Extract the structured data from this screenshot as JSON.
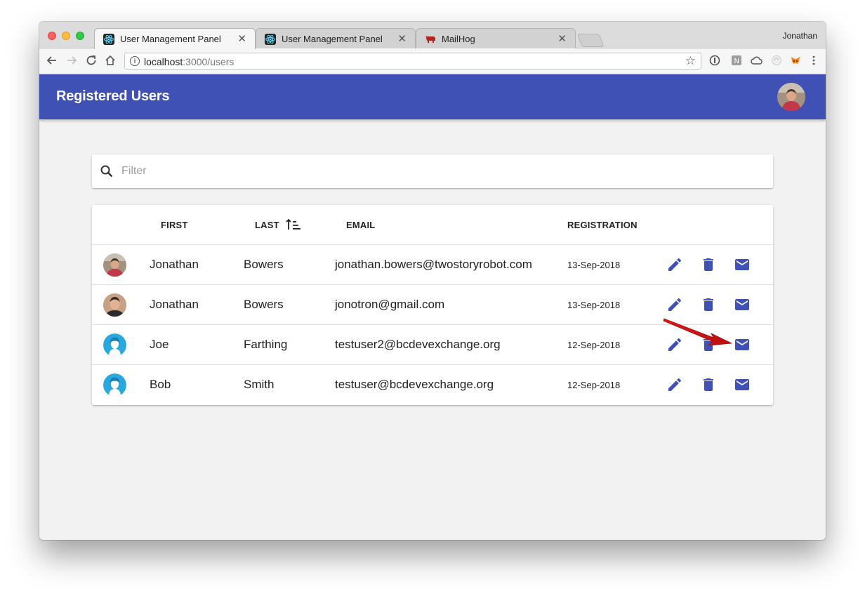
{
  "browser": {
    "profile_name": "Jonathan",
    "tabs": [
      {
        "title": "User Management Panel",
        "favicon": "react-icon",
        "active": true
      },
      {
        "title": "User Management Panel",
        "favicon": "react-icon",
        "active": false
      },
      {
        "title": "MailHog",
        "favicon": "mailhog-pig-icon",
        "active": false
      }
    ],
    "address": {
      "host": "localhost",
      "path": ":3000/users"
    }
  },
  "app": {
    "title": "Registered Users",
    "accent_color": "#3f51b5"
  },
  "filter": {
    "placeholder": "Filter",
    "value": ""
  },
  "table": {
    "columns": {
      "first": "FIRST",
      "last": "LAST",
      "email": "EMAIL",
      "registration": "REGISTRATION"
    },
    "sort": {
      "column": "last",
      "direction": "ascending"
    },
    "rows": [
      {
        "first": "Jonathan",
        "last": "Bowers",
        "email": "jonathan.bowers@twostoryrobot.com",
        "registration": "13-Sep-2018",
        "avatar": "photo-red-shirt"
      },
      {
        "first": "Jonathan",
        "last": "Bowers",
        "email": "jonotron@gmail.com",
        "registration": "13-Sep-2018",
        "avatar": "photo-headshot"
      },
      {
        "first": "Joe",
        "last": "Farthing",
        "email": "testuser2@bcdevexchange.org",
        "registration": "12-Sep-2018",
        "avatar": "default-user"
      },
      {
        "first": "Bob",
        "last": "Smith",
        "email": "testuser@bcdevexchange.org",
        "registration": "12-Sep-2018",
        "avatar": "default-user"
      }
    ],
    "row_actions": [
      "edit-icon",
      "delete-icon",
      "email-icon"
    ]
  },
  "annotation": {
    "type": "red-arrow",
    "points_to": "email-icon",
    "row": 3
  }
}
